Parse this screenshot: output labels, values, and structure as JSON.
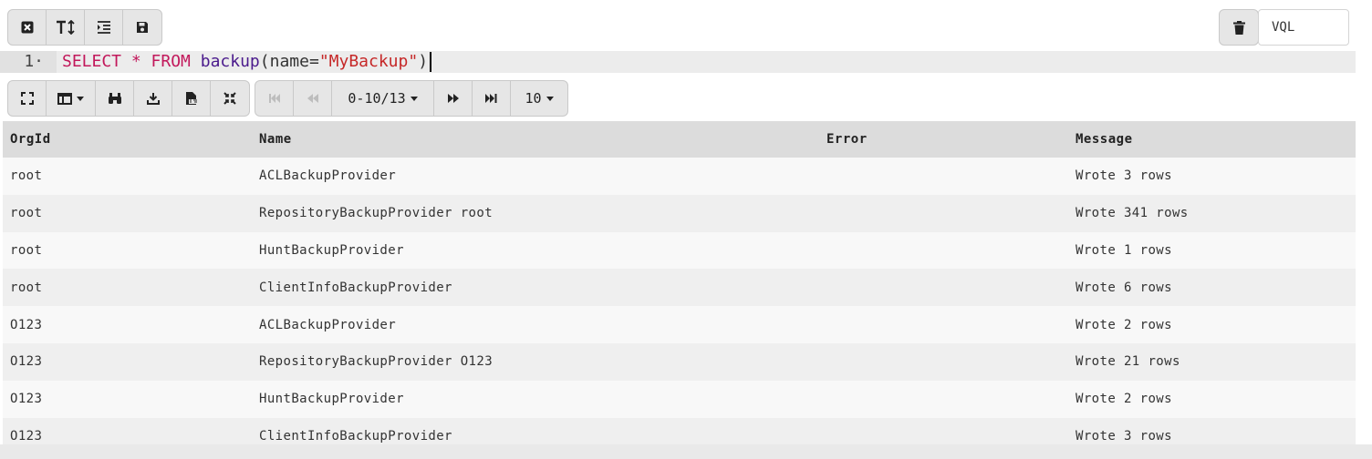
{
  "editor_toolbar": {
    "buttons": [
      {
        "name": "clear-button",
        "icon": "close-square-icon"
      },
      {
        "name": "font-size-button",
        "icon": "text-height-icon"
      },
      {
        "name": "indent-button",
        "icon": "indent-icon"
      },
      {
        "name": "save-button",
        "icon": "save-icon"
      }
    ]
  },
  "right_toolbar": {
    "delete_icon": "trash-icon",
    "language": "VQL"
  },
  "editor": {
    "line_number": "1·",
    "code": {
      "kw1": "SELECT",
      "star": " * ",
      "kw2": "FROM",
      "fn": "backup",
      "open": "(",
      "arg": "name=",
      "str": "\"MyBackup\"",
      "close": ")"
    }
  },
  "results_toolbar": {
    "page_range": "0-10/13",
    "page_size": "10"
  },
  "table": {
    "columns": [
      "OrgId",
      "Name",
      "Error",
      "Message"
    ],
    "rows": [
      [
        "root",
        "ACLBackupProvider",
        "",
        "Wrote 3 rows"
      ],
      [
        "root",
        "RepositoryBackupProvider root",
        "",
        "Wrote 341 rows"
      ],
      [
        "root",
        "HuntBackupProvider",
        "",
        "Wrote 1 rows"
      ],
      [
        "root",
        "ClientInfoBackupProvider",
        "",
        "Wrote 6 rows"
      ],
      [
        "O123",
        "ACLBackupProvider",
        "",
        "Wrote 2 rows"
      ],
      [
        "O123",
        "RepositoryBackupProvider O123",
        "",
        "Wrote 21 rows"
      ],
      [
        "O123",
        "HuntBackupProvider",
        "",
        "Wrote 2 rows"
      ],
      [
        "O123",
        "ClientInfoBackupProvider",
        "",
        "Wrote 3 rows"
      ]
    ]
  }
}
